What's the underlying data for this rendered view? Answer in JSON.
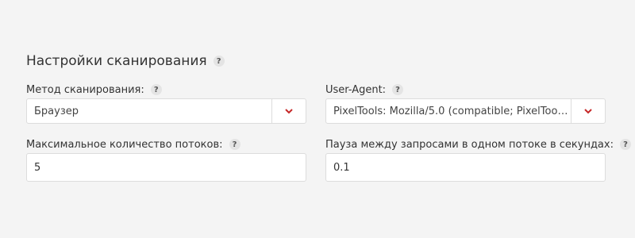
{
  "section": {
    "title": "Настройки сканирования",
    "help": "?"
  },
  "scan_method": {
    "label": "Метод сканирования:",
    "help": "?",
    "value": "Браузер"
  },
  "user_agent": {
    "label": "User-Agent:",
    "help": "?",
    "value": "PixelTools: Mozilla/5.0 (compatible; PixelTools..."
  },
  "max_threads": {
    "label": "Максимальное количество потоков:",
    "help": "?",
    "value": "5"
  },
  "pause": {
    "label": "Пауза между запросами в одном потоке в секундах:",
    "help": "?",
    "value": "0.1"
  },
  "colors": {
    "accent": "#c62828",
    "background": "#f4f4f4",
    "border": "#dcdcdc"
  },
  "icons": {
    "dropdown": "chevron-down-icon",
    "help": "question-mark-icon"
  }
}
